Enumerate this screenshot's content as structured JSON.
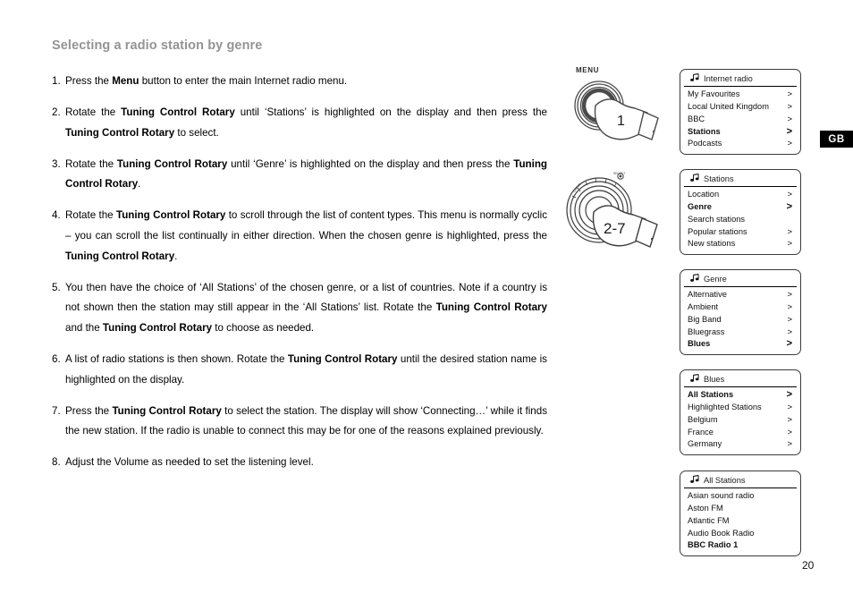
{
  "page": {
    "title": "Selecting a radio station by genre",
    "page_number": "20",
    "region_tab": "GB"
  },
  "steps": [
    {
      "num": "1.",
      "parts": [
        {
          "t": "Press the ",
          "b": false
        },
        {
          "t": "Menu",
          "b": true
        },
        {
          "t": " button to enter the main Internet radio menu.",
          "b": false
        }
      ]
    },
    {
      "num": "2.",
      "parts": [
        {
          "t": "Rotate the ",
          "b": false
        },
        {
          "t": "Tuning Control Rotary",
          "b": true
        },
        {
          "t": " until ‘Stations’ is highlighted on the display and then press the ",
          "b": false
        },
        {
          "t": "Tuning Control Rotary",
          "b": true
        },
        {
          "t": " to select.",
          "b": false
        }
      ]
    },
    {
      "num": "3.",
      "parts": [
        {
          "t": "Rotate the ",
          "b": false
        },
        {
          "t": "Tuning Control Rotary",
          "b": true
        },
        {
          "t": " until ‘Genre’ is highlighted on the display and then press the ",
          "b": false
        },
        {
          "t": "Tuning Control Rotary",
          "b": true
        },
        {
          "t": ".",
          "b": false
        }
      ]
    },
    {
      "num": "4.",
      "parts": [
        {
          "t": "Rotate the ",
          "b": false
        },
        {
          "t": "Tuning Control Rotary",
          "b": true
        },
        {
          "t": " to scroll through the list of content types. This menu is normally cyclic – you can scroll the list continually in either direction. When the chosen genre is highlighted, press the ",
          "b": false
        },
        {
          "t": "Tuning Control Rotary",
          "b": true
        },
        {
          "t": ".",
          "b": false
        }
      ]
    },
    {
      "num": "5.",
      "parts": [
        {
          "t": "You then have the choice of ‘All Stations’ of the chosen genre, or a list of countries. Note if a country is not shown then the station may still appear in the ‘All Stations’ list. Rotate the ",
          "b": false
        },
        {
          "t": "Tuning Control Rotary",
          "b": true
        },
        {
          "t": " and the ",
          "b": false
        },
        {
          "t": "Tuning Control Rotary",
          "b": true
        },
        {
          "t": " to choose as needed.",
          "b": false
        }
      ]
    },
    {
      "num": "6.",
      "parts": [
        {
          "t": "A list of radio stations is then shown. Rotate the ",
          "b": false
        },
        {
          "t": "Tuning Control Rotary",
          "b": true
        },
        {
          "t": " until the desired station name is highlighted on the display.",
          "b": false
        }
      ]
    },
    {
      "num": "7.",
      "parts": [
        {
          "t": "Press the ",
          "b": false
        },
        {
          "t": "Tuning Control Rotary",
          "b": true
        },
        {
          "t": " to select the station. The display will show ‘Connecting…’ while it finds the new station. If the radio is unable to connect this may be for one of the reasons explained previously.",
          "b": false
        }
      ]
    },
    {
      "num": "8.",
      "parts": [
        {
          "t": "Adjust the Volume as needed to set the listening level.",
          "b": false
        }
      ]
    }
  ],
  "illustrations": [
    {
      "name": "menu-button-press",
      "button_label": "MENU",
      "step_badge": "1"
    },
    {
      "name": "tuning-control-rotary",
      "button_label": "",
      "step_badge": "2-7"
    }
  ],
  "panels": [
    {
      "icon": "music-note-icon",
      "title": "Internet radio",
      "rows": [
        {
          "label": "My Favourites",
          "bold": false,
          "chevron": true
        },
        {
          "label": "Local United Kingdom",
          "bold": false,
          "chevron": true
        },
        {
          "label": "BBC",
          "bold": false,
          "chevron": true
        },
        {
          "label": "Stations",
          "bold": true,
          "chevron": true
        },
        {
          "label": "Podcasts",
          "bold": false,
          "chevron": true
        }
      ]
    },
    {
      "icon": "music-note-icon",
      "title": "Stations",
      "rows": [
        {
          "label": "Location",
          "bold": false,
          "chevron": true
        },
        {
          "label": "Genre",
          "bold": true,
          "chevron": true
        },
        {
          "label": "Search stations",
          "bold": false,
          "chevron": false
        },
        {
          "label": "Popular stations",
          "bold": false,
          "chevron": true
        },
        {
          "label": "New stations",
          "bold": false,
          "chevron": true
        }
      ]
    },
    {
      "icon": "music-note-icon",
      "title": "Genre",
      "rows": [
        {
          "label": "Alternative",
          "bold": false,
          "chevron": true
        },
        {
          "label": "Ambient",
          "bold": false,
          "chevron": true
        },
        {
          "label": "Big Band",
          "bold": false,
          "chevron": true
        },
        {
          "label": "Bluegrass",
          "bold": false,
          "chevron": true
        },
        {
          "label": "Blues",
          "bold": true,
          "chevron": true
        }
      ]
    },
    {
      "icon": "music-note-icon",
      "title": "Blues",
      "rows": [
        {
          "label": "All Stations",
          "bold": true,
          "chevron": true
        },
        {
          "label": "Highlighted Stations",
          "bold": false,
          "chevron": true
        },
        {
          "label": "Belgium",
          "bold": false,
          "chevron": true
        },
        {
          "label": "France",
          "bold": false,
          "chevron": true
        },
        {
          "label": "Germany",
          "bold": false,
          "chevron": true
        }
      ]
    },
    {
      "icon": "music-note-icon",
      "title": "All Stations",
      "rows": [
        {
          "label": "Asian sound radio",
          "bold": false,
          "chevron": false
        },
        {
          "label": "Aston FM",
          "bold": false,
          "chevron": false
        },
        {
          "label": "Atlantic FM",
          "bold": false,
          "chevron": false
        },
        {
          "label": "Audio Book Radio",
          "bold": false,
          "chevron": false
        },
        {
          "label": "BBC Radio 1",
          "bold": true,
          "chevron": false
        }
      ]
    }
  ],
  "colors": {
    "title": "#949494",
    "text": "#000000",
    "panel_border": "#3b3b3b",
    "tab_bg": "#000000",
    "tab_fg": "#ffffff"
  }
}
